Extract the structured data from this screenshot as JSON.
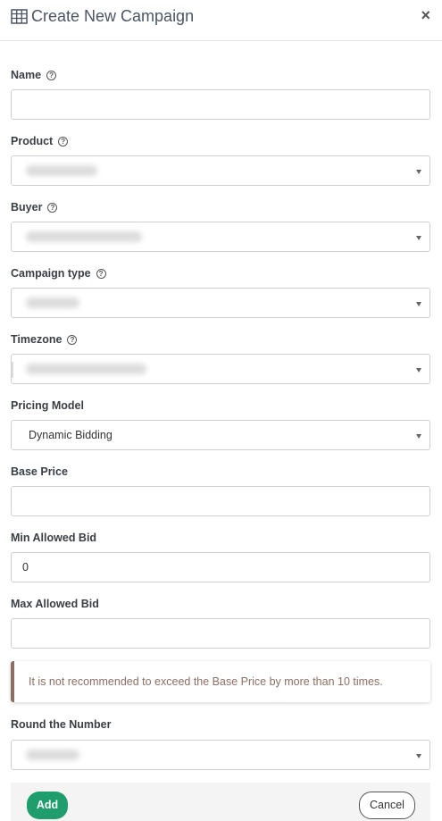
{
  "header": {
    "title": "Create New Campaign",
    "title_icon": "table-icon",
    "close_label": "×"
  },
  "form": {
    "name": {
      "label": "Name",
      "help": "?",
      "value": ""
    },
    "product": {
      "label": "Product",
      "help": "?"
    },
    "buyer": {
      "label": "Buyer",
      "help": "?"
    },
    "campaign_type": {
      "label": "Campaign type",
      "help": "?"
    },
    "timezone": {
      "label": "Timezone",
      "help": "?"
    },
    "pricing_model": {
      "label": "Pricing Model",
      "value": "Dynamic Bidding"
    },
    "base_price": {
      "label": "Base Price",
      "value": ""
    },
    "min_allowed_bid": {
      "label": "Min Allowed Bid",
      "value": "0"
    },
    "max_allowed_bid": {
      "label": "Max Allowed Bid",
      "value": ""
    },
    "round_the_number": {
      "label": "Round the Number"
    }
  },
  "alert": {
    "message": "It is not recommended to exceed the Base Price by more than 10 times.",
    "color": "#8d6e63"
  },
  "footer": {
    "add_label": "Add",
    "cancel_label": "Cancel"
  },
  "colors": {
    "accent": "#1f9d6c",
    "border": "#cfcfcf",
    "title": "#4b5563"
  }
}
